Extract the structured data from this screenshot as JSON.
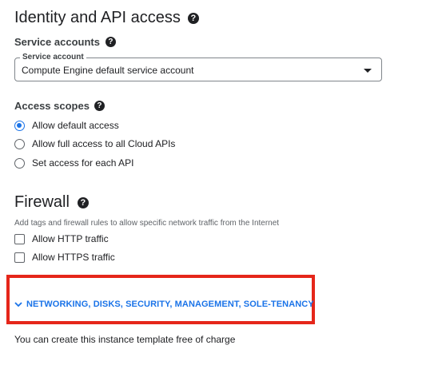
{
  "identity": {
    "title": "Identity and API access",
    "service_accounts_label": "Service accounts",
    "service_account_select": {
      "label": "Service account",
      "value": "Compute Engine default service account"
    },
    "access_scopes_label": "Access scopes",
    "scopes": [
      {
        "label": "Allow default access",
        "selected": true
      },
      {
        "label": "Allow full access to all Cloud APIs",
        "selected": false
      },
      {
        "label": "Set access for each API",
        "selected": false
      }
    ]
  },
  "firewall": {
    "title": "Firewall",
    "description": "Add tags and firewall rules to allow specific network traffic from the Internet",
    "options": [
      {
        "label": "Allow HTTP traffic",
        "checked": false
      },
      {
        "label": "Allow HTTPS traffic",
        "checked": false
      }
    ]
  },
  "expander": {
    "label": "NETWORKING, DISKS, SECURITY, MANAGEMENT, SOLE-TENANCY",
    "icon": "chevron-down-icon"
  },
  "footer": {
    "text": "You can create this instance template free of charge"
  },
  "help_icon_glyph": "?",
  "colors": {
    "accent": "#1a73e8",
    "highlight": "#e5261a",
    "text": "#202124",
    "secondary_text": "#5f6368"
  }
}
